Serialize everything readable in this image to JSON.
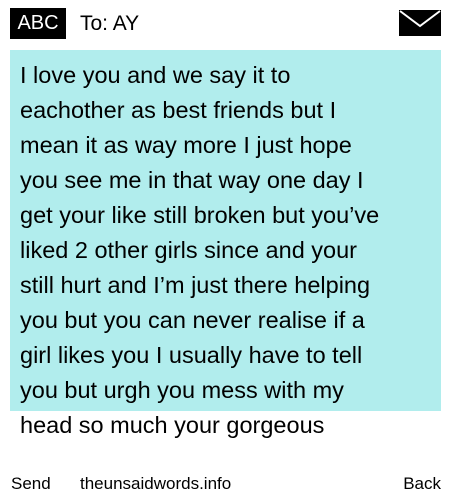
{
  "header": {
    "badge_label": "ABC",
    "to_label": "To: AY",
    "icon": "envelope-icon"
  },
  "message": {
    "text": "I love you and we say it to\neachother as best friends but I\nmean it as way more I just hope\nyou see me in that way one day I\nget your like still broken but you’ve\nliked 2 other girls since and your\nstill hurt and I’m just there helping\nyou but you can never realise if a\ngirl likes you I usually have to tell\nyou but urgh you mess with my\nhead so much your gorgeous"
  },
  "footer": {
    "send_label": "Send",
    "site_label": "theunsaidwords.info",
    "back_label": "Back"
  },
  "colors": {
    "message_background": "#b1eded",
    "badge_background": "#000000"
  }
}
